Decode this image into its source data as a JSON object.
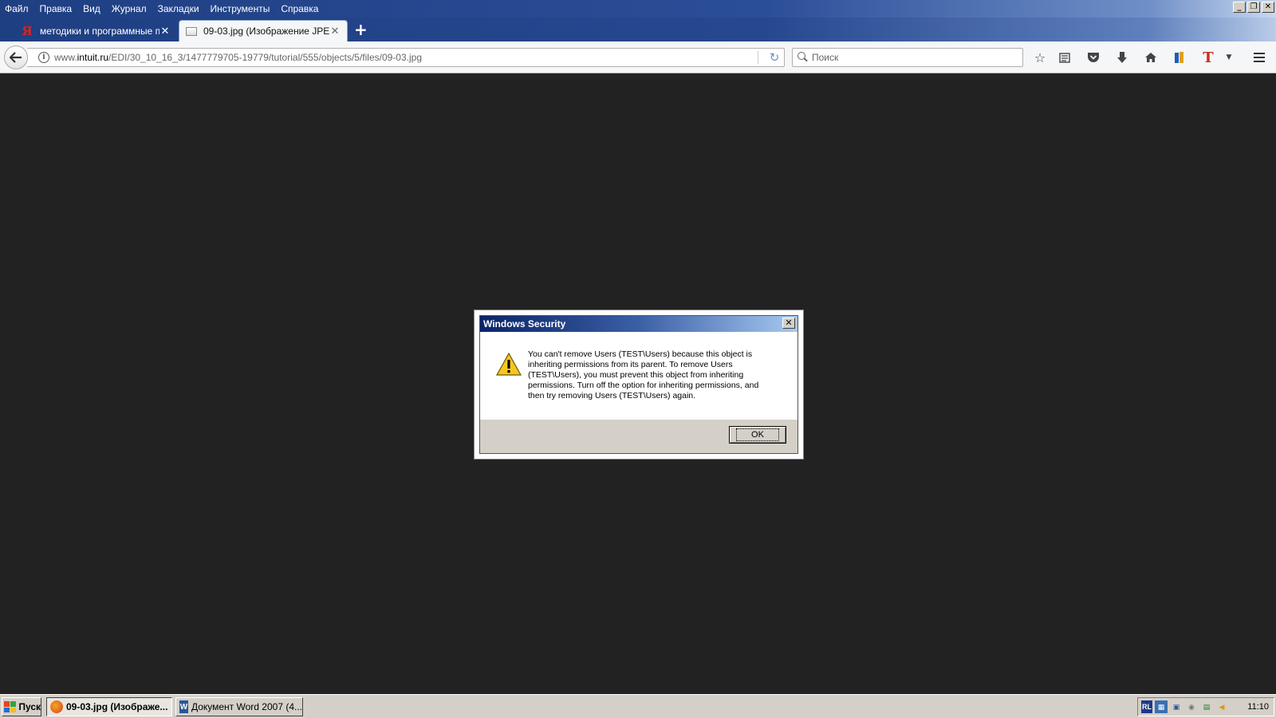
{
  "menu": [
    "Файл",
    "Правка",
    "Вид",
    "Журнал",
    "Закладки",
    "Инструменты",
    "Справка"
  ],
  "tabs": [
    {
      "label": "методики и программные пр...",
      "favicon": "yandex-icon",
      "active": false
    },
    {
      "label": "09-03.jpg (Изображение JPE...",
      "favicon": "image-file-icon",
      "active": true
    }
  ],
  "newtab_label": "+",
  "urlbar": {
    "prefix": "www.",
    "host": "intuit.ru",
    "path": "/EDI/30_10_16_3/1477779705-19779/tutorial/555/objects/5/files/09-03.jpg"
  },
  "search": {
    "placeholder": "Поиск"
  },
  "dialog": {
    "title": "Windows Security",
    "message": "You can't remove Users (TEST\\Users) because this object is inheriting permissions from its parent. To remove Users (TEST\\Users), you must prevent this object from inheriting permissions.  Turn off the option for inheriting permissions, and then try removing Users (TEST\\Users) again.",
    "ok_label": "OK"
  },
  "taskbar": {
    "start_label": "Пуск",
    "items": [
      {
        "label": "09-03.jpg (Изображе...",
        "icon": "firefox-icon",
        "active": true
      },
      {
        "label": "Документ Word 2007 (4...",
        "icon": "word-icon",
        "active": false
      }
    ],
    "tray_lang": "RL",
    "clock": "11:10"
  },
  "colors": {
    "content_bg": "#222222",
    "title_gradient_start": "#1f3f83",
    "dialog_title": "#0a246a"
  }
}
